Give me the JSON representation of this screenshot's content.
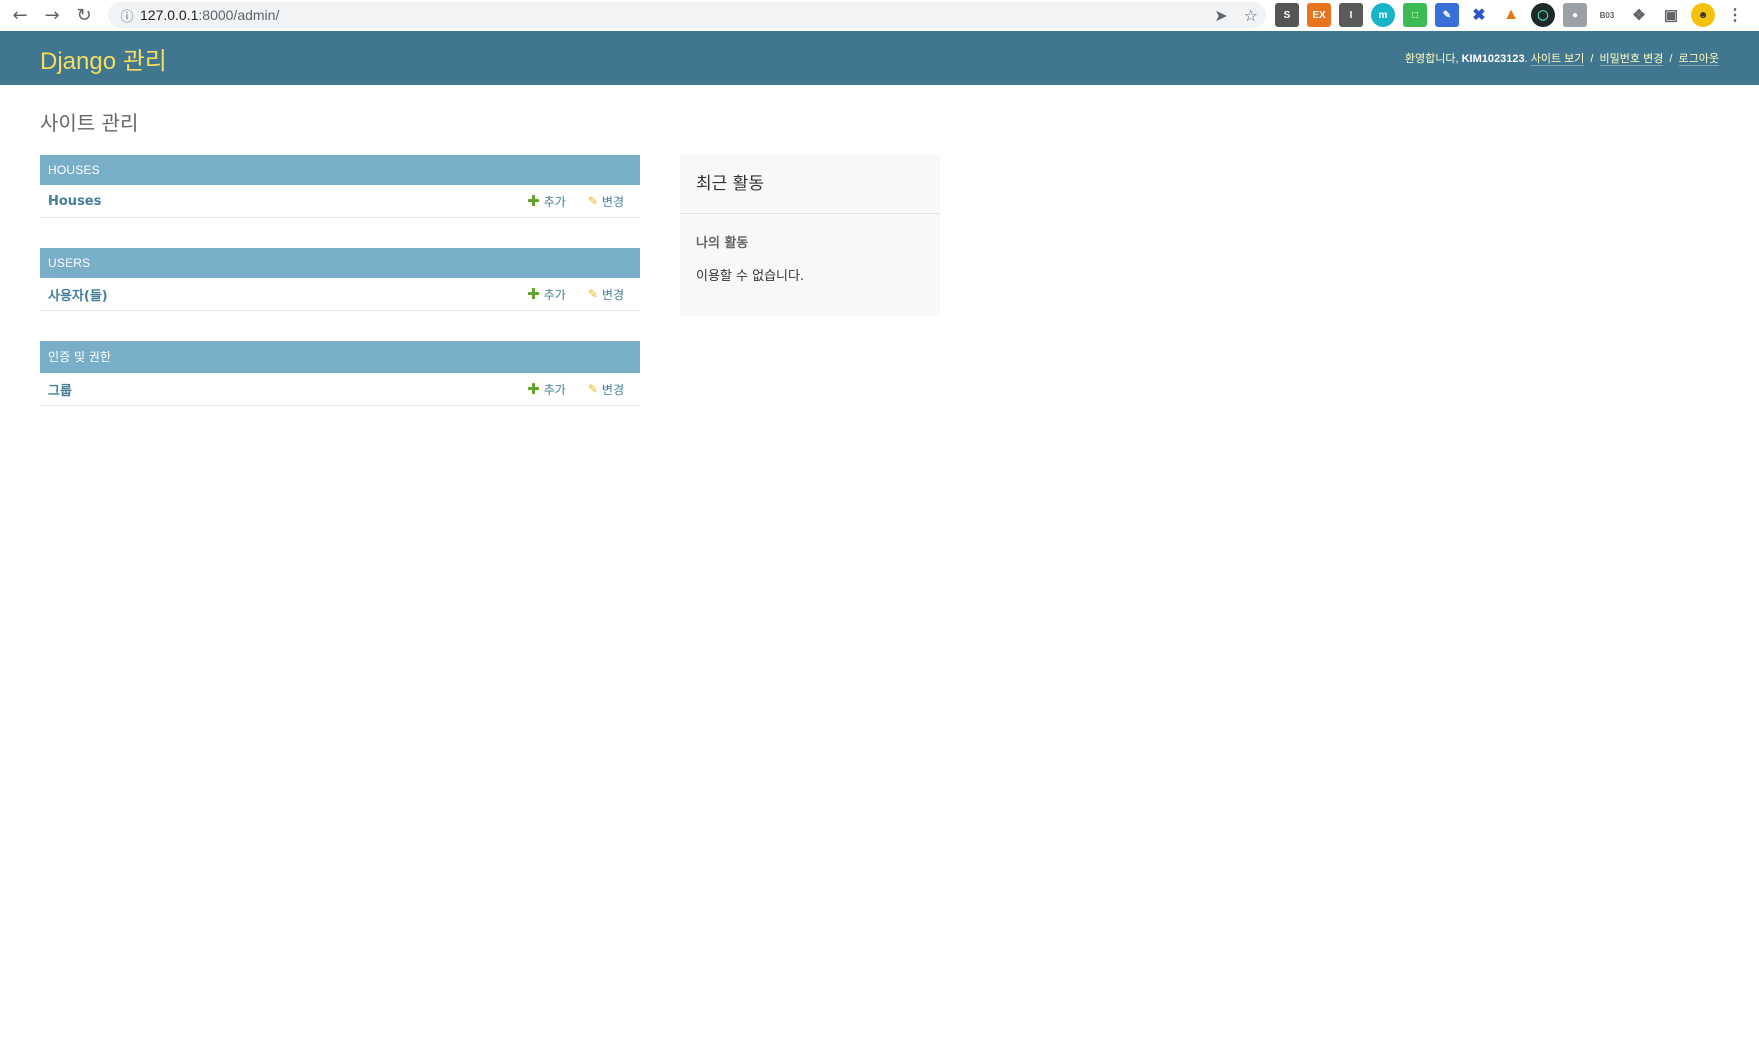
{
  "browser": {
    "url_host": "127.0.0.1",
    "url_path": ":8000/admin/"
  },
  "header": {
    "brand": "Django 관리",
    "welcome": "환영합니다,",
    "username": "KIM1023123",
    "view_site": "사이트 보기",
    "change_password": "비밀번호 변경",
    "logout": "로그아웃"
  },
  "page_title": "사이트 관리",
  "modules": [
    {
      "caption": "HOUSES",
      "model": "Houses",
      "add": "추가",
      "change": "변경"
    },
    {
      "caption": "USERS",
      "model": "사용자(들)",
      "add": "추가",
      "change": "변경"
    },
    {
      "caption": "인증 및 권한",
      "model": "그룹",
      "add": "추가",
      "change": "변경"
    }
  ],
  "recent": {
    "title": "최근 활동",
    "subtitle": "나의 활동",
    "empty": "이용할 수 없습니다."
  },
  "colors": {
    "header_bg": "#417690",
    "brand": "#f5dd5d",
    "module_caption_bg": "#79aec8",
    "link": "#447e9b",
    "add_icon": "#5fa225",
    "change_icon": "#efb80b"
  }
}
